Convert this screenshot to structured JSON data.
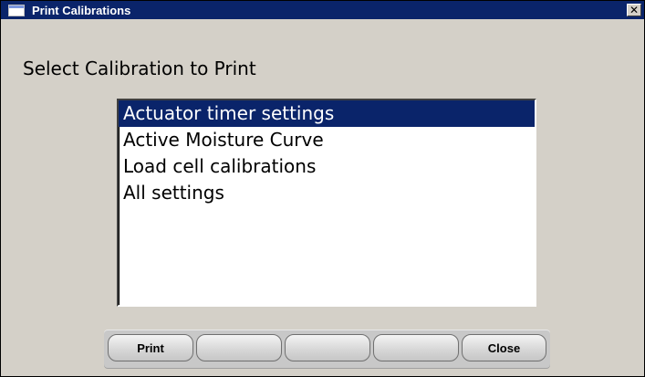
{
  "window": {
    "title": "Print Calibrations",
    "close_glyph": "✕"
  },
  "prompt": "Select Calibration to Print",
  "list": {
    "items": [
      {
        "label": "Actuator timer settings",
        "selected": true
      },
      {
        "label": "Active Moisture Curve",
        "selected": false
      },
      {
        "label": "Load cell calibrations",
        "selected": false
      },
      {
        "label": "All settings",
        "selected": false
      }
    ]
  },
  "buttons": {
    "b1": "Print",
    "b2": "",
    "b3": "",
    "b4": "",
    "b5": "Close"
  },
  "colors": {
    "titlebar": "#0a246a",
    "selection": "#0a246a",
    "window_bg": "#d4d0c8"
  },
  "icons": {
    "window": "window-icon",
    "close": "close-icon"
  }
}
